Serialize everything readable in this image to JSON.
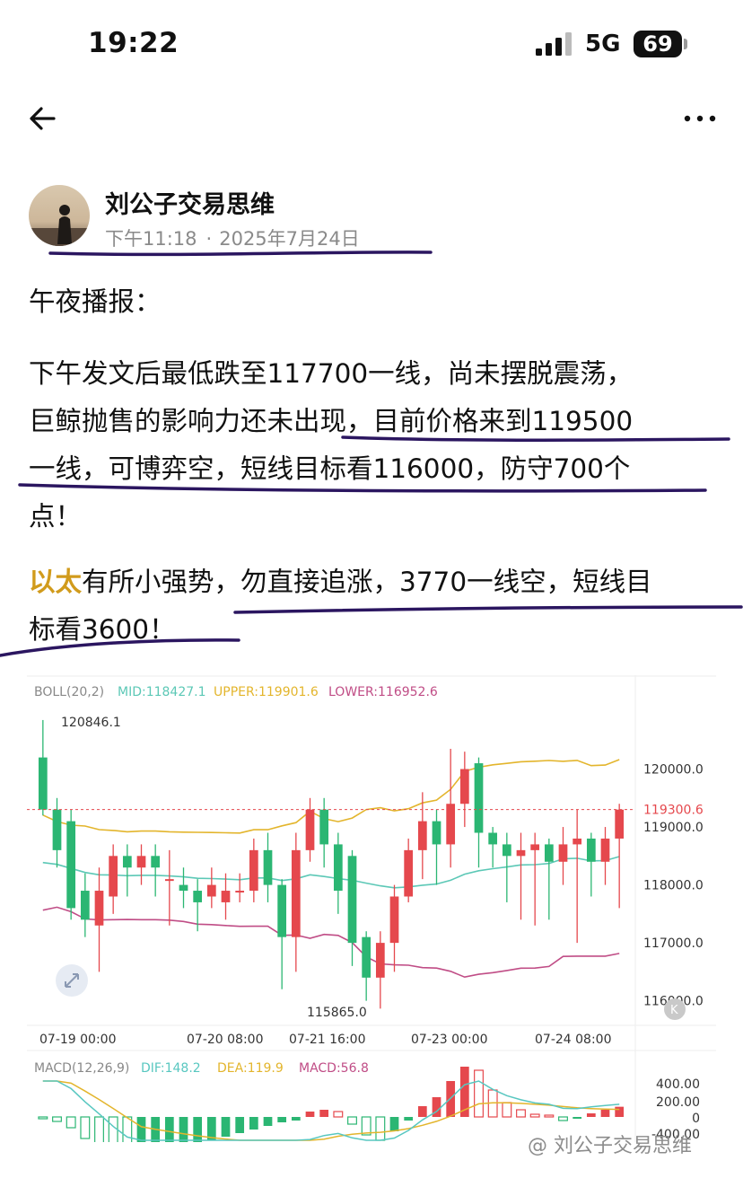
{
  "status_bar": {
    "time": "19:22",
    "network": "5G",
    "battery": "69"
  },
  "nav": {
    "back_icon": "arrow-left-icon",
    "more_icon": "more-horizontal-icon"
  },
  "post": {
    "author": "刘公子交易思维",
    "time": "下午11:18",
    "date": "2025年7月24日",
    "heading": "午夜播报：",
    "para1_lines": [
      "下午发文后最低跌至117700一线，尚未摆脱震荡，",
      "巨鲸抛售的影响力还未出现，目前价格来到119500",
      "一线，可博弈空，短线目标看116000，防守700个",
      "点！"
    ],
    "para2_highlight": "以太",
    "para2_line1_rest": "有所小强势，勿直接追涨，3770一线空，短线目",
    "para2_line2": "标看3600！"
  },
  "chart_data": {
    "type": "candlestick",
    "colors": {
      "up": "#e5484d",
      "down": "#2bb673",
      "mid": "#5cc8b6",
      "upper": "#e3b52c",
      "lower": "#c04d86",
      "dif": "#58c7c0",
      "dea": "#e3b52c"
    },
    "boll": {
      "title": "BOLL(20,2)",
      "mid": "MID:118427.1",
      "upper": "UPPER:119901.6",
      "lower": "LOWER:116952.6"
    },
    "price_labels": [
      "120000.0",
      "119000.0",
      "118000.0",
      "117000.0",
      "116000.0"
    ],
    "current_price": "119300.6",
    "high_label": "120846.1",
    "low_label": "115865.0",
    "x_labels": [
      "07-19 00:00",
      "07-20 08:00",
      "07-21 16:00",
      "07-23 00:00",
      "07-24 08:00"
    ],
    "macd": {
      "title": "MACD(12,26,9)",
      "dif": "DIF:148.2",
      "dea": "DEA:119.9",
      "macd": "MACD:56.8"
    },
    "macd_labels": [
      "400.00",
      "200.00",
      "0",
      "-400.00"
    ],
    "ylim": [
      115700,
      121000
    ],
    "candles": [
      [
        120200,
        119300,
        120846,
        119200
      ],
      [
        119300,
        118600,
        119500,
        118300
      ],
      [
        119100,
        117600,
        119300,
        117400
      ],
      [
        117900,
        117400,
        118200,
        117100
      ],
      [
        117300,
        117900,
        118300,
        116500
      ],
      [
        117800,
        118500,
        118700,
        117500
      ],
      [
        118500,
        118300,
        118700,
        117800
      ],
      [
        118300,
        118500,
        118700,
        118000
      ],
      [
        118500,
        118300,
        118700,
        117800
      ],
      [
        118100,
        118100,
        118600,
        117300
      ],
      [
        118000,
        117900,
        118300,
        117600
      ],
      [
        117900,
        117700,
        118100,
        117200
      ],
      [
        117800,
        118000,
        118300,
        117600
      ],
      [
        117700,
        117900,
        118200,
        117400
      ],
      [
        117900,
        117900,
        118200,
        117700
      ],
      [
        117900,
        118600,
        118800,
        117700
      ],
      [
        118600,
        118000,
        118900,
        117700
      ],
      [
        118000,
        117100,
        118100,
        116200
      ],
      [
        117100,
        118600,
        118900,
        116500
      ],
      [
        118600,
        119300,
        119500,
        118400
      ],
      [
        119300,
        118700,
        119500,
        118300
      ],
      [
        118700,
        117900,
        118900,
        117500
      ],
      [
        118500,
        117000,
        118600,
        116600
      ],
      [
        117100,
        116400,
        117200,
        116000
      ],
      [
        116400,
        117000,
        117200,
        115865
      ],
      [
        117000,
        117800,
        118000,
        116500
      ],
      [
        117800,
        118600,
        118800,
        117700
      ],
      [
        118600,
        119100,
        119600,
        118100
      ],
      [
        119100,
        118700,
        119300,
        118000
      ],
      [
        118700,
        119400,
        120350,
        118300
      ],
      [
        119400,
        120000,
        120300,
        119000
      ],
      [
        120100,
        118900,
        120200,
        118300
      ],
      [
        118900,
        118700,
        119000,
        118300
      ],
      [
        118700,
        118500,
        118900,
        117700
      ],
      [
        118500,
        118600,
        118900,
        117400
      ],
      [
        118600,
        118700,
        118900,
        117300
      ],
      [
        118700,
        118400,
        118800,
        117400
      ],
      [
        118400,
        118700,
        119000,
        118000
      ],
      [
        118700,
        118800,
        119300,
        117000
      ],
      [
        118800,
        118400,
        118900,
        117800
      ],
      [
        118400,
        118800,
        119000,
        118000
      ],
      [
        118800,
        119300,
        119400,
        117600
      ]
    ],
    "macd_hist": [
      -10,
      -25,
      -60,
      -120,
      -160,
      -200,
      -215,
      -200,
      -190,
      -175,
      -165,
      -150,
      -130,
      -110,
      -90,
      -70,
      -50,
      -30,
      -20,
      30,
      40,
      30,
      -40,
      -100,
      -130,
      -80,
      -20,
      60,
      110,
      200,
      280,
      260,
      150,
      80,
      40,
      15,
      10,
      -20,
      -10,
      20,
      40,
      56.8
    ]
  },
  "watermark": "@ 刘公子交易思维"
}
